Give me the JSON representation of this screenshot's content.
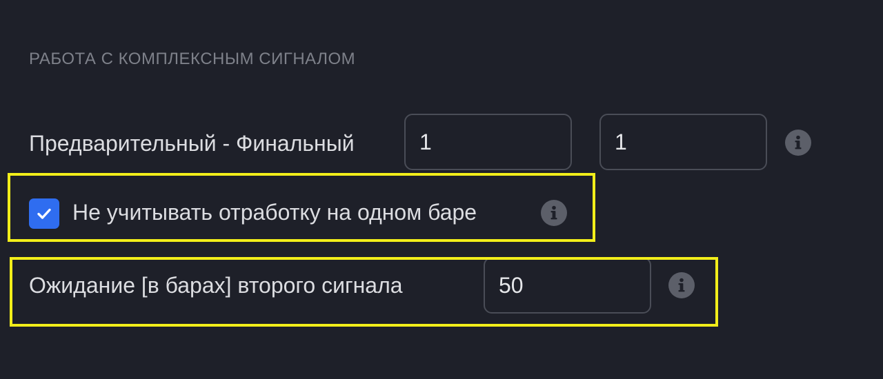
{
  "section": {
    "title": "РАБОТА С КОМПЛЕКСНЫМ СИГНАЛОМ"
  },
  "rows": {
    "pre_final": {
      "label": "Предварительный - Финальный",
      "first_value": "1",
      "second_value": "1",
      "info_icon": "info-icon"
    },
    "ignore_same_bar": {
      "checked": true,
      "label": "Не учитывать отработку на одном баре",
      "info_icon": "info-icon"
    },
    "wait_bars": {
      "label": "Ожидание [в барах] второго сигнала",
      "value": "50",
      "info_icon": "info-icon"
    }
  },
  "colors": {
    "background": "#1e2029",
    "checkbox": "#2f6df0",
    "highlight": "#f2ee1a",
    "info_icon": "#5c5f69",
    "field_border": "#4a4d57"
  }
}
